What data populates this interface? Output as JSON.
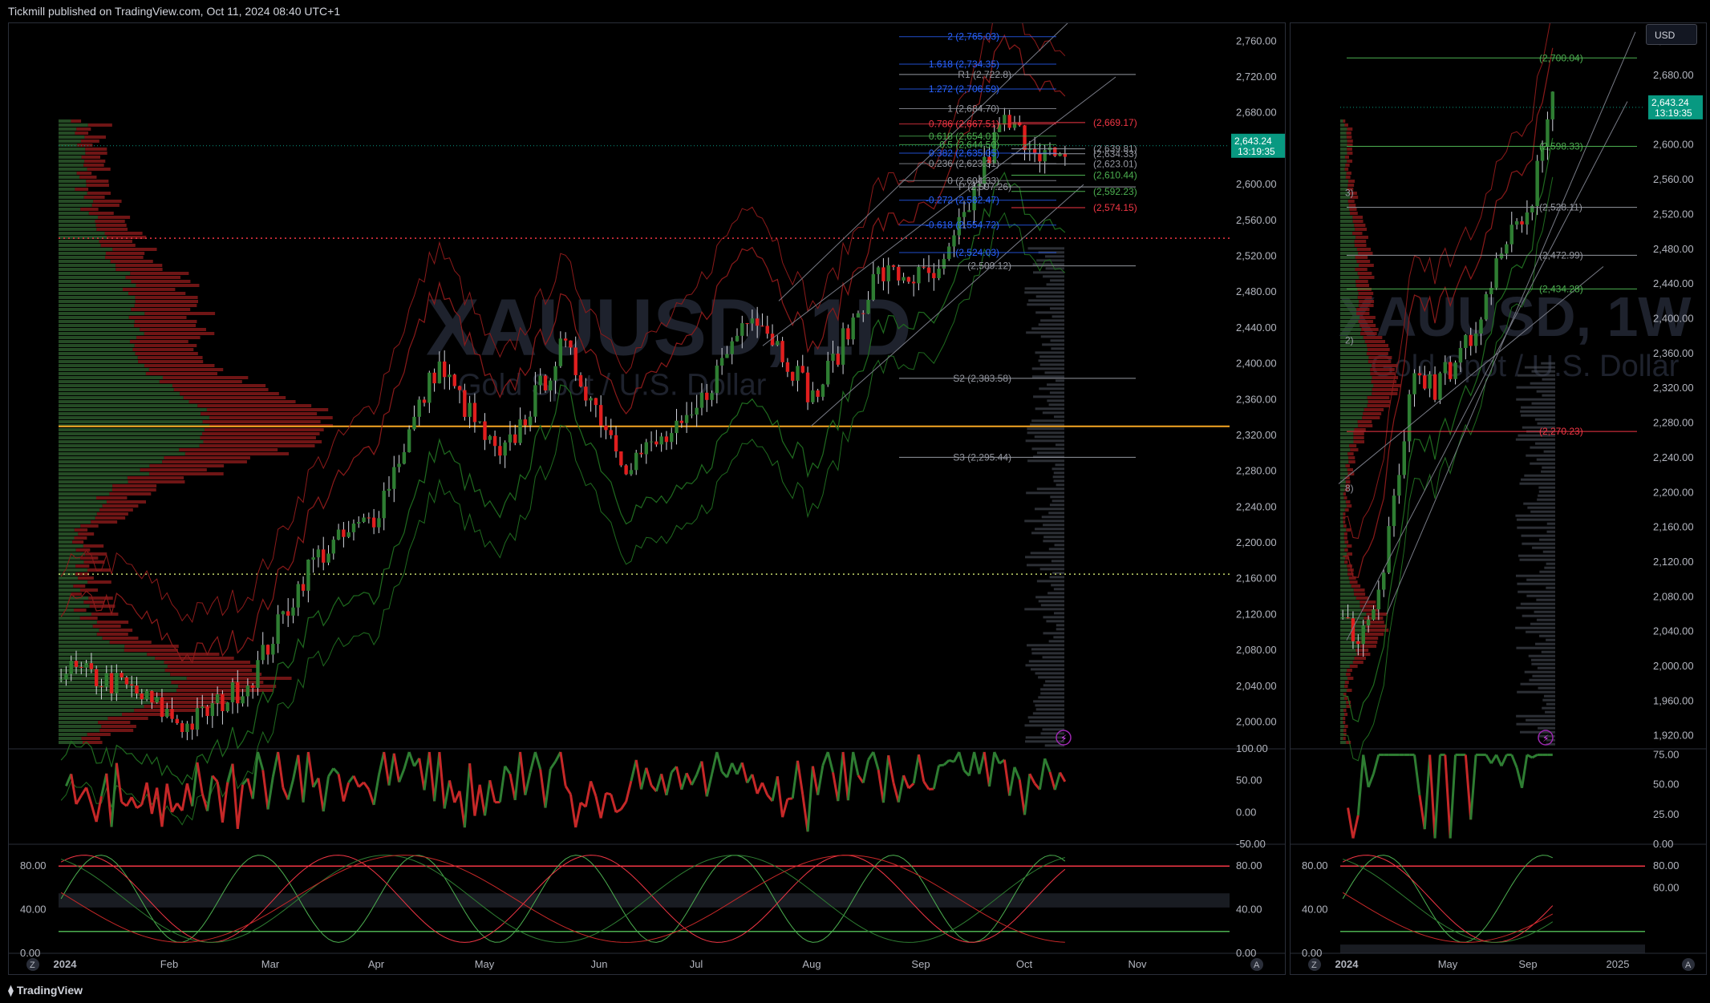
{
  "header": {
    "publisher_text": "Tickmill published on TradingView.com, Oct 11, 2024 08:40 UTC+1"
  },
  "footer": {
    "brand": "TradingView"
  },
  "currency_button": "USD",
  "colors": {
    "up": "#2e7d32",
    "down": "#e01e1e",
    "bg": "#000000",
    "grid": "#1a1a1a",
    "poc": "#f5a623",
    "price_tag": "#089981"
  },
  "icons": [
    "tradingview-logo-icon",
    "lightning-icon",
    "zoom-z-icon",
    "auto-a-icon"
  ],
  "chart_data": [
    {
      "type": "candlestick",
      "panel": "left",
      "symbol_watermark": "XAUUSD, 1D",
      "subtitle_watermark": "Gold Spot / U.S. Dollar",
      "timeframe": "1D",
      "ylim": [
        1970,
        2780
      ],
      "y_ticks": [
        "2,760.00",
        "2,720.00",
        "2,680.00",
        "2,640.00",
        "2,600.00",
        "2,560.00",
        "2,520.00",
        "2,480.00",
        "2,440.00",
        "2,400.00",
        "2,360.00",
        "2,320.00",
        "2,280.00",
        "2,240.00",
        "2,200.00",
        "2,160.00",
        "2,120.00",
        "2,080.00",
        "2,040.00",
        "2,000.00"
      ],
      "x_labels": [
        "2024",
        "Feb",
        "Mar",
        "Apr",
        "May",
        "Jun",
        "Jul",
        "Aug",
        "Sep",
        "Oct",
        "Nov"
      ],
      "last_price": "2,643.24",
      "countdown": "13:19:35",
      "close_series_monthly_anchor": [
        {
          "date": "2024-01-02",
          "close": 2060
        },
        {
          "date": "2024-01-31",
          "close": 2040
        },
        {
          "date": "2024-02-14",
          "close": 1995
        },
        {
          "date": "2024-02-29",
          "close": 2045
        },
        {
          "date": "2024-03-08",
          "close": 2180
        },
        {
          "date": "2024-03-31",
          "close": 2230
        },
        {
          "date": "2024-04-12",
          "close": 2400
        },
        {
          "date": "2024-04-30",
          "close": 2290
        },
        {
          "date": "2024-05-20",
          "close": 2420
        },
        {
          "date": "2024-06-07",
          "close": 2290
        },
        {
          "date": "2024-06-30",
          "close": 2330
        },
        {
          "date": "2024-07-17",
          "close": 2465
        },
        {
          "date": "2024-07-25",
          "close": 2360
        },
        {
          "date": "2024-08-20",
          "close": 2500
        },
        {
          "date": "2024-09-06",
          "close": 2495
        },
        {
          "date": "2024-09-26",
          "close": 2670
        },
        {
          "date": "2024-10-10",
          "close": 2620
        }
      ],
      "fib_levels": [
        {
          "label": "2 (2,765.03)",
          "value": 2765.03,
          "color": "#2962ff"
        },
        {
          "label": "1.618 (2,734.35)",
          "value": 2734.35,
          "color": "#2962ff"
        },
        {
          "label": "1.272 (2,706.59)",
          "value": 2706.59,
          "color": "#2962ff"
        },
        {
          "label": "1 (2,684.70)",
          "value": 2684.7,
          "color": "#9598a1"
        },
        {
          "label": "0.786 (2,667.51)",
          "value": 2667.51,
          "color": "#f23645"
        },
        {
          "label": "0.618 (2,654.01)",
          "value": 2654.01,
          "color": "#4caf50"
        },
        {
          "label": "0.5 (2,644.50)",
          "value": 2644.5,
          "color": "#4caf50"
        },
        {
          "label": "0.382 (2,635.05)",
          "value": 2635.05,
          "color": "#2962ff"
        },
        {
          "label": "0.236 (2,623.31)",
          "value": 2623.31,
          "color": "#9598a1"
        },
        {
          "label": "0 (2,604.33)",
          "value": 2604.33,
          "color": "#9598a1"
        },
        {
          "label": "-0.272 (2,582.47)",
          "value": 2582.47,
          "color": "#2962ff"
        },
        {
          "label": "-0.618 (2,554.72)",
          "value": 2554.72,
          "color": "#2962ff"
        },
        {
          "label": "(2,524.03)",
          "value": 2524.03,
          "color": "#2962ff"
        }
      ],
      "pivots": [
        {
          "label": "R1 (2,722.8)",
          "value": 2722.8
        },
        {
          "label": "P (2,597.26)",
          "value": 2597.26
        },
        {
          "label": "(2,509.12)",
          "value": 2509.12
        },
        {
          "label": "S2 (2,383.58)",
          "value": 2383.58
        },
        {
          "label": "S3 (2,295.44)",
          "value": 2295.44
        }
      ],
      "right_levels": [
        {
          "label": "(2,669.17)",
          "value": 2669.17,
          "color": "#f23645"
        },
        {
          "label": "(2,639.81)",
          "value": 2639.81,
          "color": "#9598a1"
        },
        {
          "label": "(2,634.33)",
          "value": 2634.33,
          "color": "#9598a1"
        },
        {
          "label": "(2,623.01)",
          "value": 2623.01,
          "color": "#9598a1"
        },
        {
          "label": "(2,610.44)",
          "value": 2610.44,
          "color": "#4caf50"
        },
        {
          "label": "(2,592.23)",
          "value": 2592.23,
          "color": "#4caf50"
        },
        {
          "label": "(2,574.15)",
          "value": 2574.15,
          "color": "#f23645"
        }
      ],
      "horizontal_lines": [
        {
          "value": 2540,
          "style": "dotted",
          "color": "#f23645"
        },
        {
          "value": 2330,
          "style": "solid",
          "color": "#f5a623"
        },
        {
          "value": 2165,
          "style": "dotted",
          "color": "#c5d86d"
        }
      ],
      "rsi": {
        "ylim": [
          -50,
          100
        ],
        "ticks": [
          "100.00",
          "50.00",
          "0.00",
          "-50.00"
        ]
      },
      "stoch": {
        "ylim": [
          0,
          100
        ],
        "ticks_left": [
          "80.00",
          "40.00",
          "0.00"
        ],
        "ticks_right": [
          "80.00",
          "40.00",
          "0.00"
        ]
      }
    },
    {
      "type": "candlestick",
      "panel": "right",
      "symbol_watermark": "XAUUSD, 1W",
      "subtitle_watermark": "Gold Spot / U.S. Dollar",
      "timeframe": "1W",
      "ylim": [
        1905,
        2740
      ],
      "y_ticks": [
        "2,720.00",
        "2,680.00",
        "2,640.00",
        "2,600.00",
        "2,560.00",
        "2,520.00",
        "2,480.00",
        "2,440.00",
        "2,400.00",
        "2,360.00",
        "2,320.00",
        "2,280.00",
        "2,240.00",
        "2,200.00",
        "2,160.00",
        "2,120.00",
        "2,080.00",
        "2,040.00",
        "2,000.00",
        "1,960.00",
        "1,920.00"
      ],
      "x_labels": [
        "2024",
        "May",
        "Sep",
        "2025"
      ],
      "last_price": "2,643.24",
      "countdown": "13:19:35",
      "levels": [
        {
          "label": "(2,700.04)",
          "value": 2700.04,
          "color": "#4caf50"
        },
        {
          "label": "(2,598.33)",
          "value": 2598.33,
          "color": "#4caf50"
        },
        {
          "label": "(2,528.11)",
          "value": 2528.11,
          "color": "#9598a1"
        },
        {
          "label": "(2,472.99)",
          "value": 2472.99,
          "color": "#9598a1"
        },
        {
          "label": "(2,434.28)",
          "value": 2434.28,
          "color": "#4caf50"
        },
        {
          "label": "(2,270.23)",
          "value": 2270.23,
          "color": "#f23645"
        }
      ],
      "edge_labels": [
        "3)",
        "2)",
        "8)"
      ],
      "rsi": {
        "ticks": [
          "75.00",
          "50.00",
          "25.00",
          "0.00"
        ]
      },
      "stoch": {
        "ticks_left": [
          "80.00",
          "40.00",
          "0.00"
        ],
        "ticks_right": [
          "80.00",
          "60.00"
        ]
      }
    }
  ]
}
